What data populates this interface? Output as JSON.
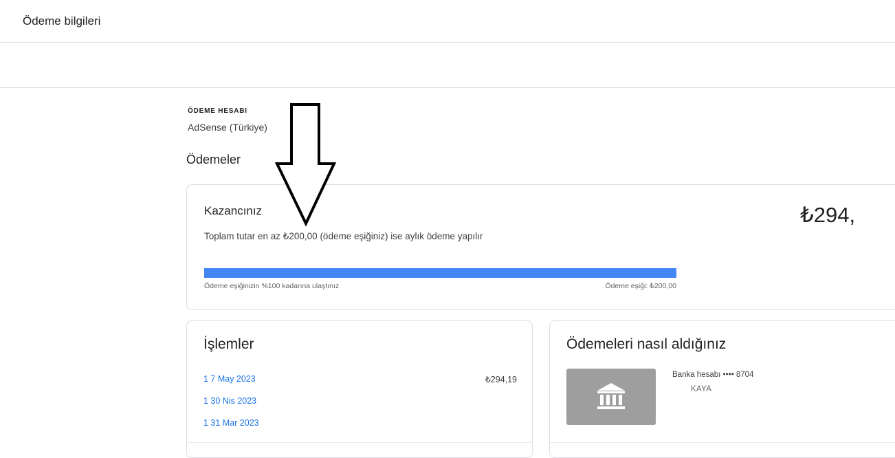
{
  "header": {
    "title": "Ödeme bilgileri"
  },
  "account": {
    "label": "ÖDEME HESABI",
    "name": "AdSense (Türkiye)"
  },
  "payments_section": {
    "title": "Ödemeler"
  },
  "earnings": {
    "title": "Kazancınız",
    "description": "Toplam tutar en az ₺200,00 (ödeme eşiğiniz) ise aylık ödeme yapılır",
    "amount": "₺294,",
    "progress_percent": 100,
    "progress_left_label": "Ödeme eşiğinizin %100 kadarına ulaştınız",
    "progress_right_label": "Ödeme eşiği: ₺200,00",
    "bar_color": "#4285f4"
  },
  "transactions": {
    "title": "İşlemler",
    "rows": [
      {
        "date": "1  7 May 2023",
        "amount": "₺294,19"
      },
      {
        "date": "1  30 Nis 2023",
        "amount": ""
      },
      {
        "date": "1  31 Mar 2023",
        "amount": ""
      }
    ]
  },
  "payment_method": {
    "title": "Ödemeleri nasıl aldığınız",
    "icon": "bank-icon",
    "bank_line": "Banka hesabı •••• 8704",
    "holder": "KAYA"
  },
  "annotation": {
    "icon": "down-arrow-icon"
  }
}
